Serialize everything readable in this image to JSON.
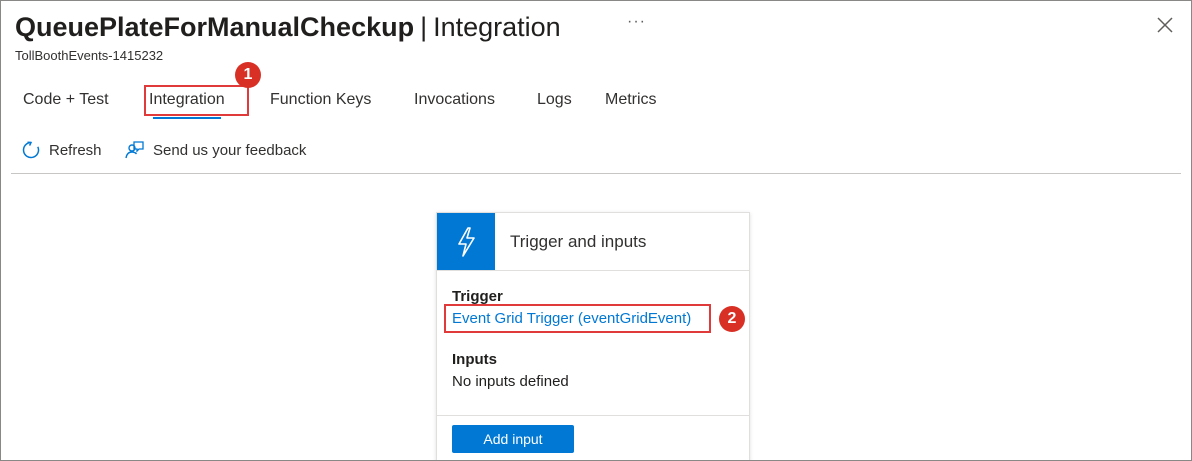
{
  "header": {
    "title_main": "QueuePlateForManualCheckup",
    "title_sep": "|",
    "title_sub": "Integration",
    "more_label": "···",
    "subtitle": "TollBoothEvents-1415232"
  },
  "tabs": [
    {
      "label": "Code + Test",
      "active": false
    },
    {
      "label": "Integration",
      "active": true
    },
    {
      "label": "Function Keys",
      "active": false
    },
    {
      "label": "Invocations",
      "active": false
    },
    {
      "label": "Logs",
      "active": false
    },
    {
      "label": "Metrics",
      "active": false
    }
  ],
  "toolbar": {
    "refresh_label": "Refresh",
    "feedback_label": "Send us your feedback"
  },
  "card": {
    "title": "Trigger and inputs",
    "trigger_heading": "Trigger",
    "trigger_link": "Event Grid Trigger (eventGridEvent)",
    "inputs_heading": "Inputs",
    "inputs_text": "No inputs defined",
    "add_input_label": "Add input"
  },
  "annotations": {
    "badge1": "1",
    "badge2": "2"
  },
  "colors": {
    "accent": "#0078d4",
    "highlight": "#e03a3a",
    "badge": "#d93025"
  }
}
